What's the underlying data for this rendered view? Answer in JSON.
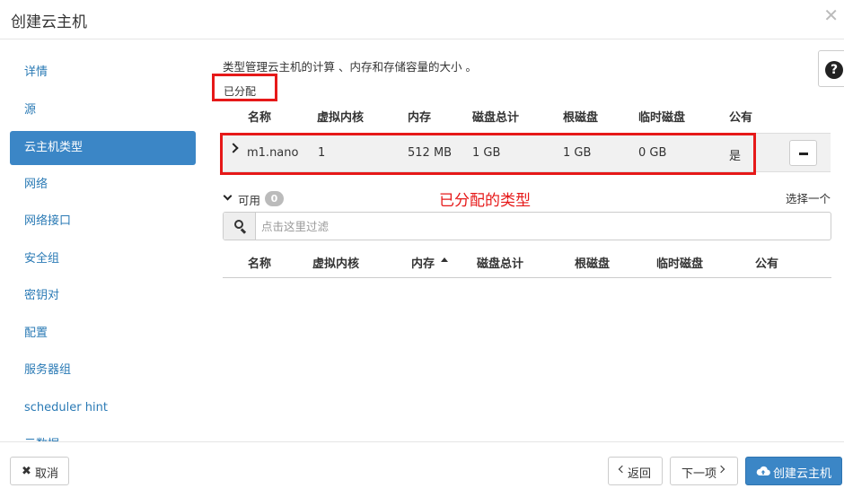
{
  "modal": {
    "title": "创建云主机"
  },
  "sidebar": {
    "items": [
      {
        "label": "详情"
      },
      {
        "label": "源"
      },
      {
        "label": "云主机类型"
      },
      {
        "label": "网络"
      },
      {
        "label": "网络接口"
      },
      {
        "label": "安全组"
      },
      {
        "label": "密钥对"
      },
      {
        "label": "配置"
      },
      {
        "label": "服务器组"
      },
      {
        "label": "scheduler hint"
      },
      {
        "label": "元数据"
      }
    ],
    "active_index": 2
  },
  "main": {
    "description": "类型管理云主机的计算 、内存和存储容量的大小 。",
    "allocated": {
      "label": "已分配",
      "columns": [
        "名称",
        "虚拟内核",
        "内存",
        "磁盘总计",
        "根磁盘",
        "临时磁盘",
        "公有"
      ],
      "rows": [
        {
          "name": "m1.nano",
          "vcpus": "1",
          "memory": "512 MB",
          "disk_total": "1 GB",
          "root_disk": "1 GB",
          "ephemeral_disk": "0 GB",
          "public": "是"
        }
      ]
    },
    "available": {
      "label": "可用",
      "count": "0",
      "select_one": "选择一个",
      "search_placeholder": "点击这里过滤",
      "columns": [
        "名称",
        "虚拟内核",
        "内存",
        "磁盘总计",
        "根磁盘",
        "临时磁盘",
        "公有"
      ],
      "sorted_column": "内存"
    },
    "annotation": "已分配的类型"
  },
  "footer": {
    "cancel": "取消",
    "back": "返回",
    "next": "下一项",
    "launch": "创建云主机"
  },
  "colors": {
    "accent": "#3b86c6",
    "annotation_red": "#e61919",
    "link": "#2a7ab5"
  },
  "icons": [
    "close-icon",
    "question-icon",
    "chevron-right-icon",
    "minus-icon",
    "chevron-down-icon",
    "search-icon",
    "sort-up-icon",
    "times-icon",
    "chevron-left-icon",
    "cloud-upload-icon"
  ]
}
